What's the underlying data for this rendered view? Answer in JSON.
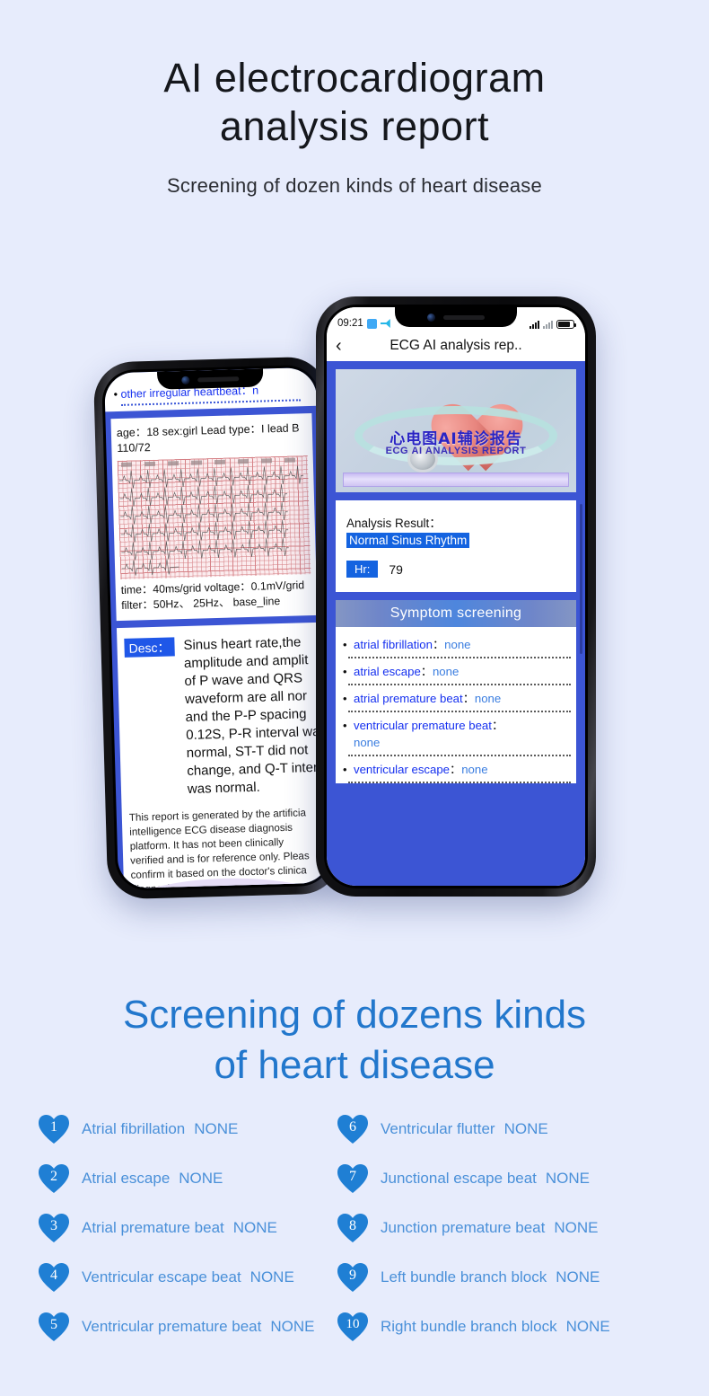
{
  "hero": {
    "title_line1": "AI electrocardiogram",
    "title_line2": "analysis report",
    "subtitle": "Screening of dozen kinds of heart disease"
  },
  "left_phone": {
    "top_item": {
      "bullet_text": "other irregular heartbeat",
      "colon": "：",
      "value": "n"
    },
    "meta_line1": "age：18   sex:girl  Lead type：I lead   B",
    "meta_line2": "110/72",
    "foot_line1": "time：40ms/grid   voltage：0.1mV/grid",
    "foot_line2": "filter：50Hz、 25Hz、 base_line",
    "desc_tag": "Desc：",
    "desc_lines": [
      "Sinus heart rate,the",
      "amplitude and amplit",
      "of P wave and QRS",
      "waveform are all nor",
      "and the P-P spacing",
      "0.12S, P-R interval wa",
      "normal, ST-T did not",
      "change, and Q-T inter",
      "was normal."
    ],
    "disclaimer_lines": [
      "This report is generated by the artificia",
      "intelligence ECG disease diagnosis",
      "platform. It has not been clinically",
      "verified and is for reference only. Pleas",
      "confirm it based on the doctor's clinica",
      "diagnosis."
    ]
  },
  "right_phone": {
    "status": {
      "time": "09:21",
      "battery_icon": "battery-icon"
    },
    "nav": {
      "back_icon": "chevron-left-icon",
      "title": "ECG AI analysis rep.."
    },
    "banner": {
      "cn_title": "心电图AI辅诊报告",
      "en_title": "ECG AI ANALYSIS REPORT"
    },
    "result": {
      "label": "Analysis Result：",
      "value": "Normal Sinus Rhythm",
      "hr_label": "Hr:",
      "hr_value": "79"
    },
    "section_title": "Symptom screening",
    "symptoms": [
      {
        "name": "atrial fibrillation",
        "colon": "：",
        "value": "none"
      },
      {
        "name": "atrial escape",
        "colon": "：",
        "value": "none"
      },
      {
        "name": "atrial premature beat",
        "colon": "：",
        "value": "none"
      },
      {
        "name": "ventricular premature beat",
        "colon": "：",
        "value": "none"
      },
      {
        "name": "ventricular escape",
        "colon": "：",
        "value": "none"
      }
    ]
  },
  "bottom": {
    "title_line1": "Screening of dozens kinds",
    "title_line2": "of heart disease",
    "items_left": [
      {
        "n": "1",
        "name": "Atrial fibrillation",
        "status": "NONE"
      },
      {
        "n": "2",
        "name": "Atrial escape",
        "status": "NONE"
      },
      {
        "n": "3",
        "name": "Atrial premature beat",
        "status": "NONE"
      },
      {
        "n": "4",
        "name": "Ventricular escape beat",
        "status": "NONE"
      },
      {
        "n": "5",
        "name": "Ventricular premature beat",
        "status": "NONE"
      }
    ],
    "items_right": [
      {
        "n": "6",
        "name": "Ventricular flutter",
        "status": "NONE"
      },
      {
        "n": "7",
        "name": "Junctional escape beat",
        "status": "NONE"
      },
      {
        "n": "8",
        "name": "Junction premature beat",
        "status": "NONE"
      },
      {
        "n": "9",
        "name": "Left bundle branch block",
        "status": "NONE"
      },
      {
        "n": "10",
        "name": "Right bundle branch block",
        "status": "NONE"
      }
    ]
  },
  "colors": {
    "background": "#e7ecfc",
    "app_blue": "#3c55d4",
    "accent_blue": "#2277cc",
    "list_blue": "#4a90d9",
    "heart_blue": "#1f7fd4",
    "tag_blue": "#1463e0"
  }
}
